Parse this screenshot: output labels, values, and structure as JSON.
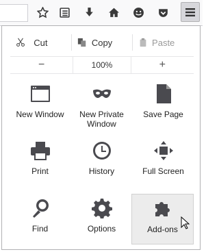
{
  "toolbar": {
    "icons": [
      "star-icon",
      "reading-list-icon",
      "download-icon",
      "home-icon",
      "emoji-icon",
      "pocket-icon"
    ],
    "menu_button": "hamburger-menu-icon"
  },
  "edit": {
    "cut": "Cut",
    "copy": "Copy",
    "paste": "Paste"
  },
  "zoom": {
    "minus": "−",
    "value": "100%",
    "plus": "+"
  },
  "grid": [
    {
      "label": "New Window",
      "icon": "window-icon"
    },
    {
      "label": "New Private\nWindow",
      "icon": "private-mask-icon"
    },
    {
      "label": "Save Page",
      "icon": "page-icon"
    },
    {
      "label": "Print",
      "icon": "printer-icon"
    },
    {
      "label": "History",
      "icon": "clock-icon"
    },
    {
      "label": "Full Screen",
      "icon": "fullscreen-icon"
    },
    {
      "label": "Find",
      "icon": "magnifier-icon"
    },
    {
      "label": "Options",
      "icon": "gear-icon"
    },
    {
      "label": "Add-ons",
      "icon": "puzzle-icon"
    }
  ],
  "state": {
    "hovered_item": "Add-ons"
  }
}
